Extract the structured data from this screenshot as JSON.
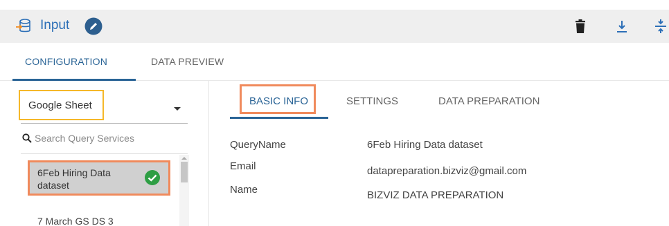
{
  "header": {
    "title": "Input",
    "db_icon": "database-input-icon",
    "edit_icon": "pencil-circle-icon",
    "actions": [
      {
        "name": "delete",
        "icon": "trash-icon"
      },
      {
        "name": "download",
        "icon": "download-icon"
      },
      {
        "name": "collapse",
        "icon": "collapse-vertical-icon"
      }
    ]
  },
  "tabs": {
    "configuration": "CONFIGURATION",
    "data_preview": "DATA PREVIEW"
  },
  "left_panel": {
    "source_select": "Google Sheet",
    "search_placeholder": "Search Query Services",
    "items": [
      {
        "label": "6Feb Hiring Data dataset",
        "selected": true
      },
      {
        "label": "7 March GS DS 3",
        "selected": false
      }
    ]
  },
  "subtabs": {
    "basic_info": "BASIC INFO",
    "settings": "SETTINGS",
    "data_preparation": "DATA PREPARATION"
  },
  "info": {
    "query_name_label": "QueryName",
    "query_name_value": "6Feb Hiring Data dataset",
    "email_label": "Email",
    "email_value": "datapreparation.bizviz@gmail.com",
    "name_label": "Name",
    "name_value": "BIZVIZ DATA PREPARATION"
  },
  "colors": {
    "accent": "#2a6496",
    "title_blue": "#2c6fb7",
    "highlight_yellow": "#f5b829",
    "highlight_orange": "#f08a5c",
    "check_green": "#2e9e44"
  }
}
